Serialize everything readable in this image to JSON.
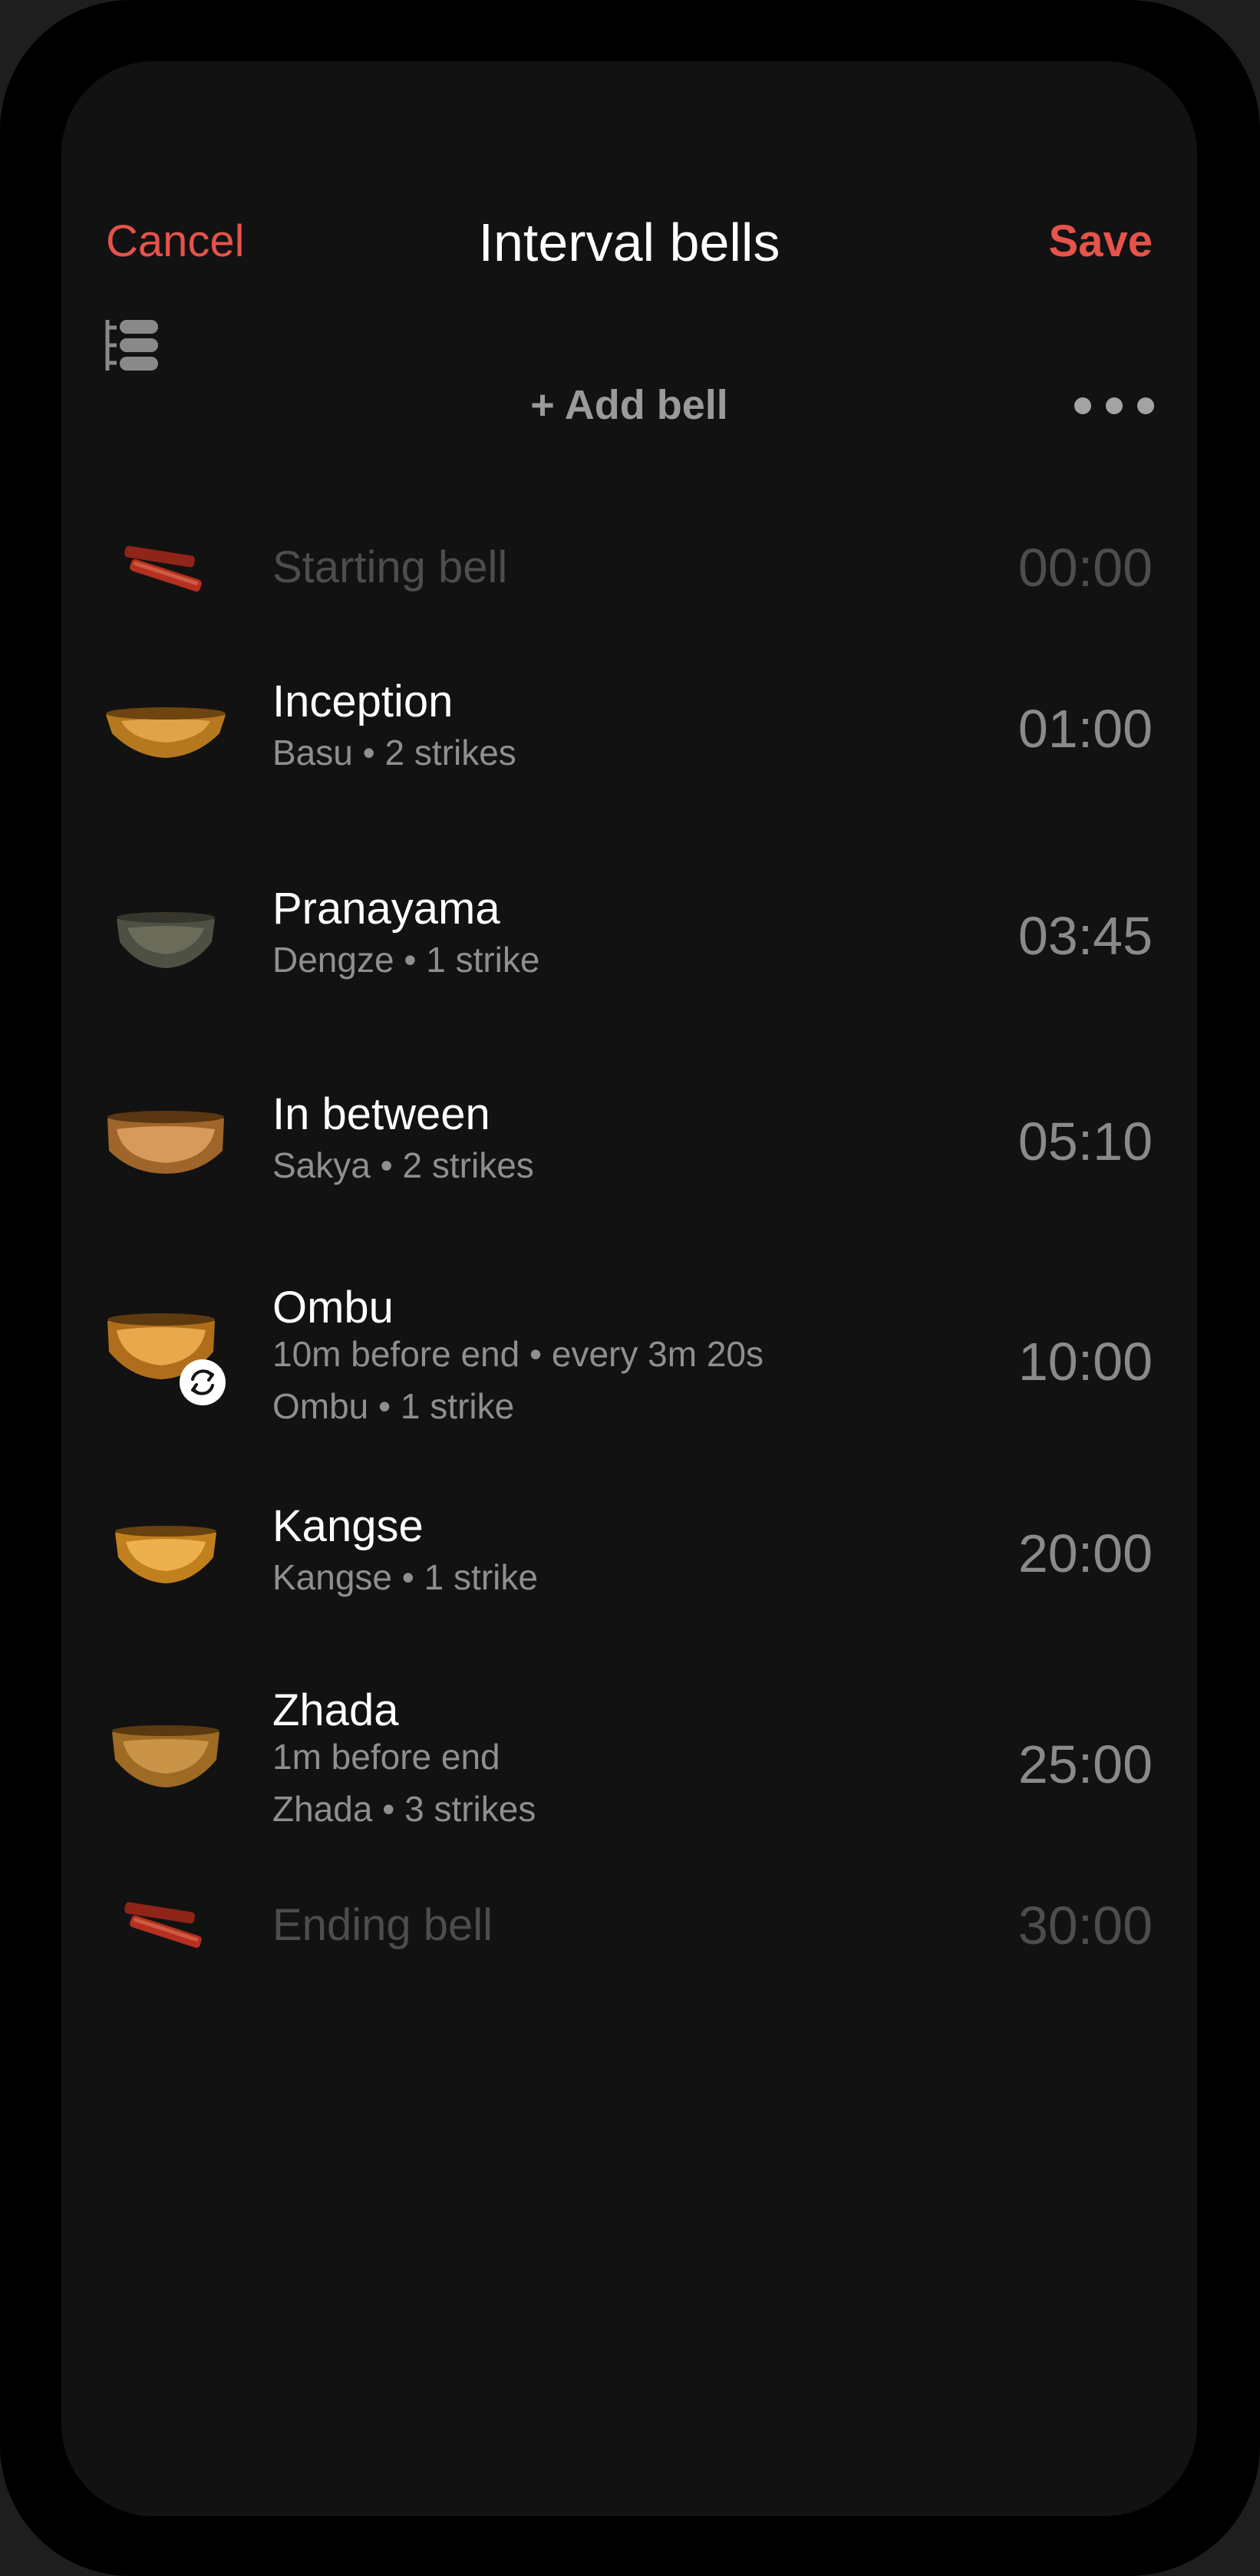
{
  "nav": {
    "cancel_label": "Cancel",
    "title": "Interval bells",
    "save_label": "Save"
  },
  "toolbar": {
    "list_icon": "list-reorder-icon",
    "add_label": "+ Add bell",
    "more_icon": "more-dots-icon"
  },
  "bells": [
    {
      "name": "Starting bell",
      "time": "00:00",
      "icon": "striker-icon"
    },
    {
      "name": "Inception",
      "details": "Basu • 2 strikes",
      "time": "01:00",
      "icon": "bowl-icon"
    },
    {
      "name": "Pranayama",
      "details": "Dengze • 1 strike",
      "time": "03:45",
      "icon": "bowl-icon"
    },
    {
      "name": "In between",
      "details": "Sakya • 2 strikes",
      "time": "05:10",
      "icon": "bowl-icon"
    },
    {
      "name": "Ombu",
      "schedule": "10m before end • every 3m 20s",
      "details": "Ombu • 1 strike",
      "time": "10:00",
      "icon": "bowl-icon",
      "badge": "repeat-icon"
    },
    {
      "name": "Kangse",
      "details": "Kangse • 1 strike",
      "time": "20:00",
      "icon": "bowl-icon"
    },
    {
      "name": "Zhada",
      "schedule": "1m before end",
      "details": "Zhada • 3 strikes",
      "time": "25:00",
      "icon": "bowl-icon"
    },
    {
      "name": "Ending bell",
      "time": "30:00",
      "icon": "striker-icon"
    }
  ],
  "colors": {
    "accent": "#e5534b",
    "background": "#121212",
    "primary_text": "#ffffff",
    "secondary_text": "#8f8f8f",
    "dim_text": "#4d4d4d"
  }
}
